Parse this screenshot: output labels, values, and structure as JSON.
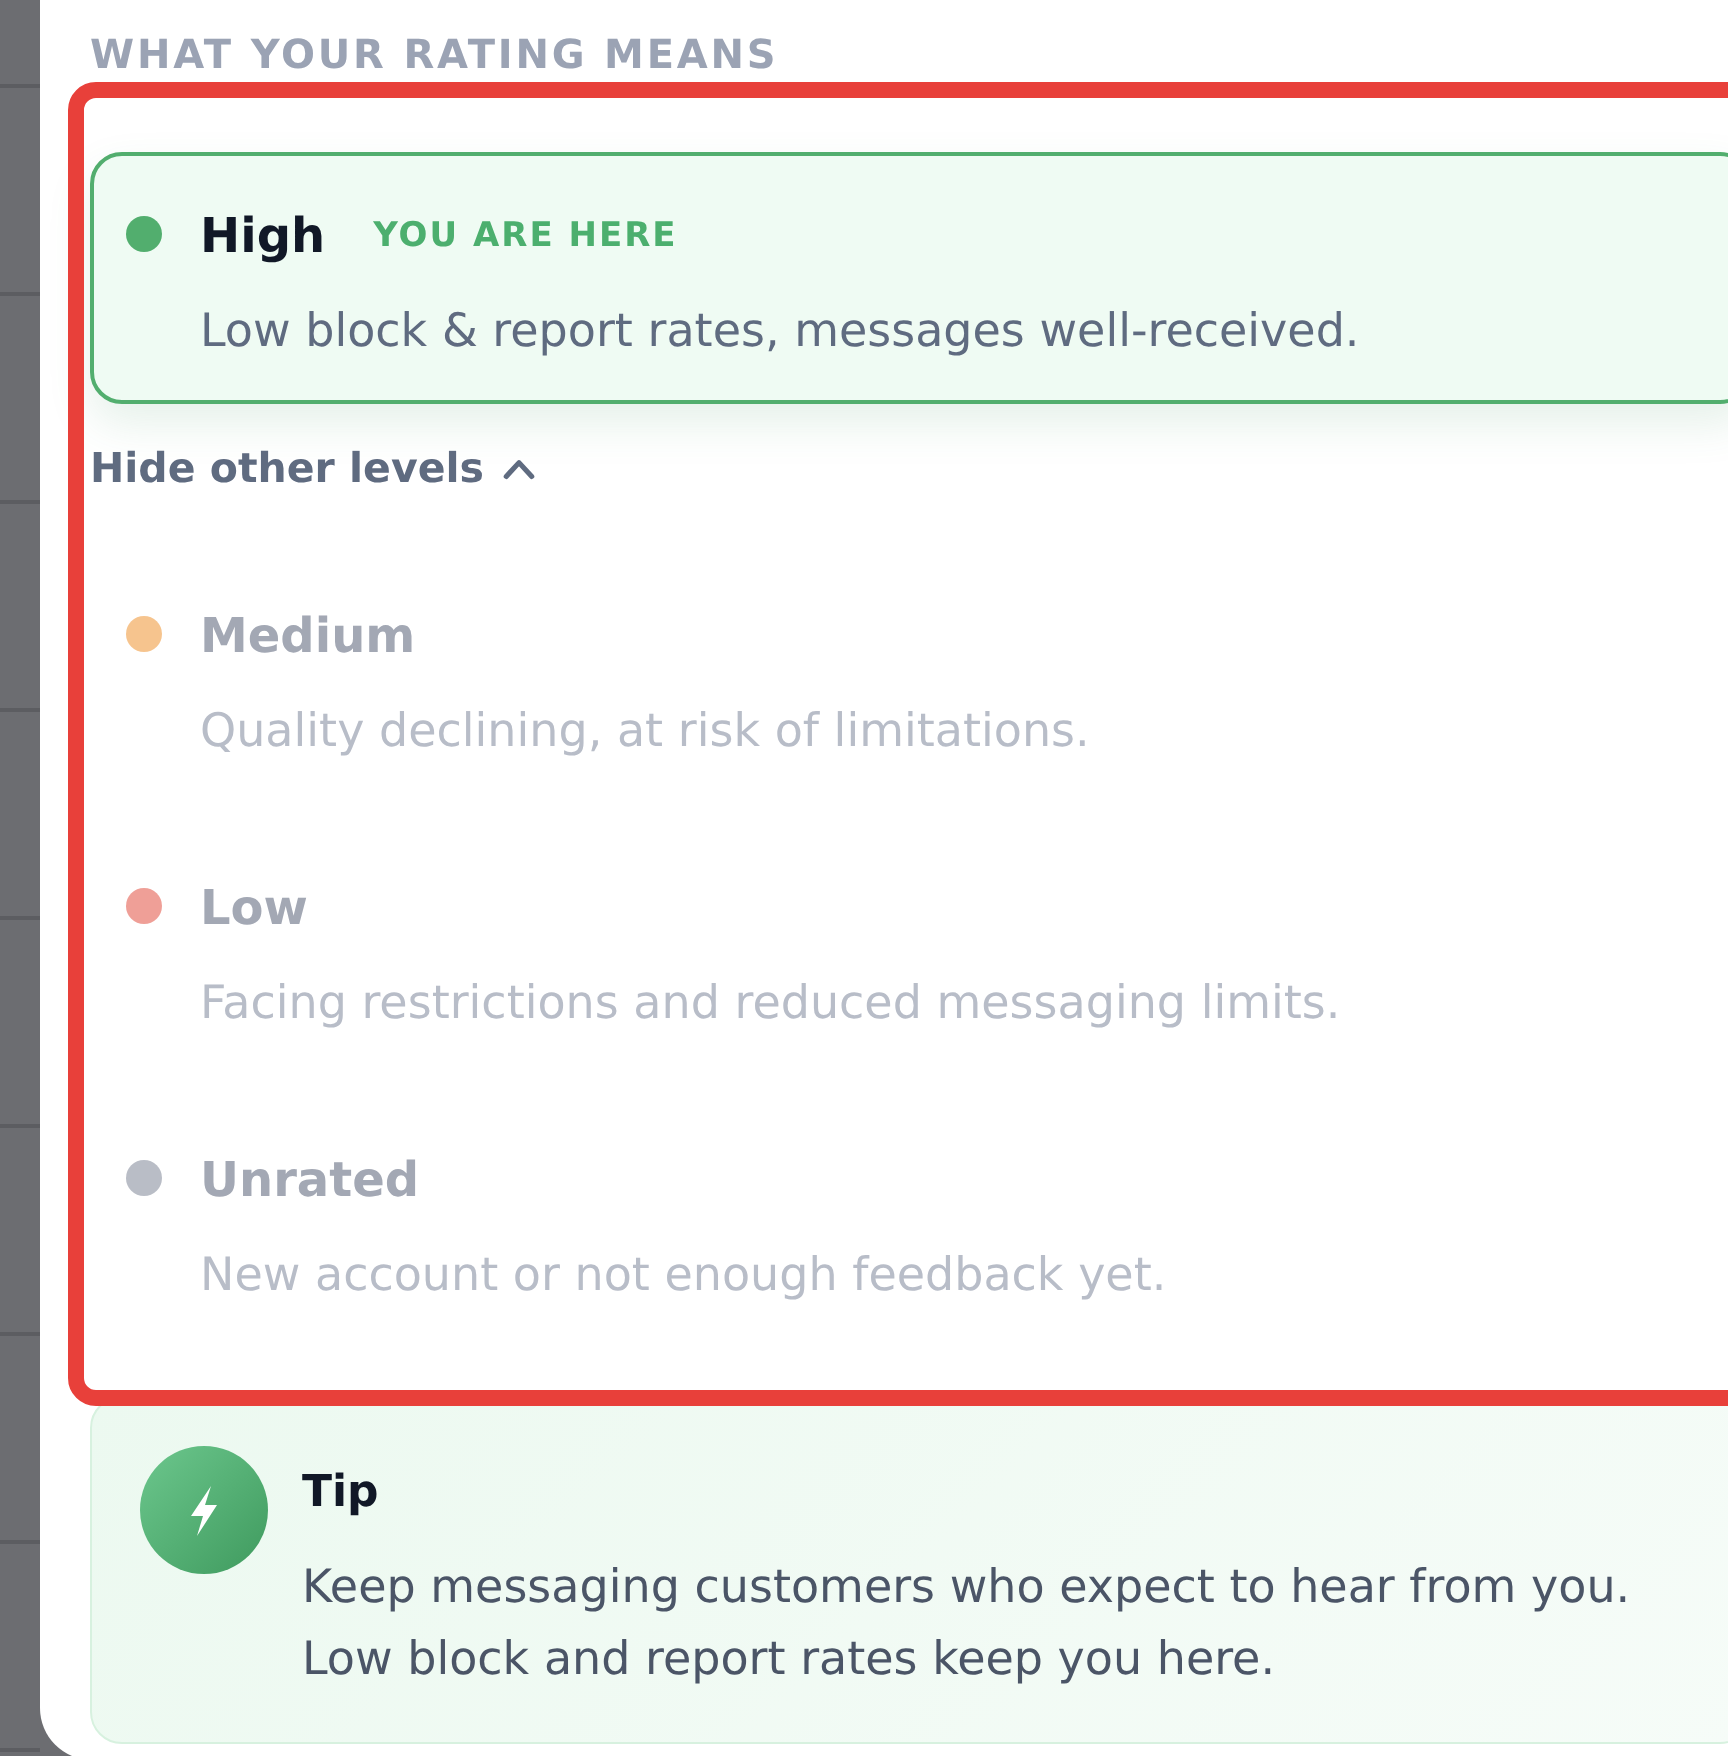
{
  "section_heading": "WHAT YOUR RATING MEANS",
  "levels": [
    {
      "name": "High",
      "badge": "YOU ARE HERE",
      "description": "Low block & report rates, messages well-received.",
      "color": "#52ae6e",
      "selected": true
    },
    {
      "name": "Medium",
      "description": "Quality declining, at risk of limitations.",
      "color": "#f6c48e",
      "selected": false
    },
    {
      "name": "Low",
      "description": "Facing restrictions and reduced messaging limits.",
      "color": "#ef9f97",
      "selected": false
    },
    {
      "name": "Unrated",
      "description": "New account or not enough feedback yet.",
      "color": "#b9bdc6",
      "selected": false
    }
  ],
  "other_levels_toggle": {
    "label": "Hide other levels",
    "expanded": true
  },
  "tip": {
    "title": "Tip",
    "text": "Keep messaging customers who expect to hear from you. Low block and report rates keep you here."
  }
}
